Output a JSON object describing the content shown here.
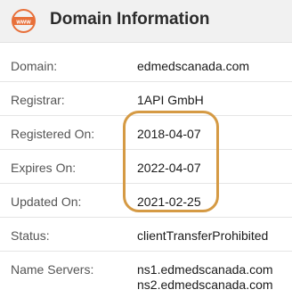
{
  "header": {
    "icon_label": "www",
    "title": "Domain Information",
    "accent_color": "#e8703a"
  },
  "rows": [
    {
      "label": "Domain:",
      "value": "edmedscanada.com"
    },
    {
      "label": "Registrar:",
      "value": "1API GmbH"
    },
    {
      "label": "Registered On:",
      "value": "2018-04-07"
    },
    {
      "label": "Expires On:",
      "value": "2022-04-07"
    },
    {
      "label": "Updated On:",
      "value": "2021-02-25"
    },
    {
      "label": "Status:",
      "value": "clientTransferProhibited"
    }
  ],
  "name_servers": {
    "label": "Name Servers:",
    "values": [
      "ns1.edmedscanada.com",
      "ns2.edmedscanada.com"
    ]
  },
  "highlight_color": "#d59a44"
}
